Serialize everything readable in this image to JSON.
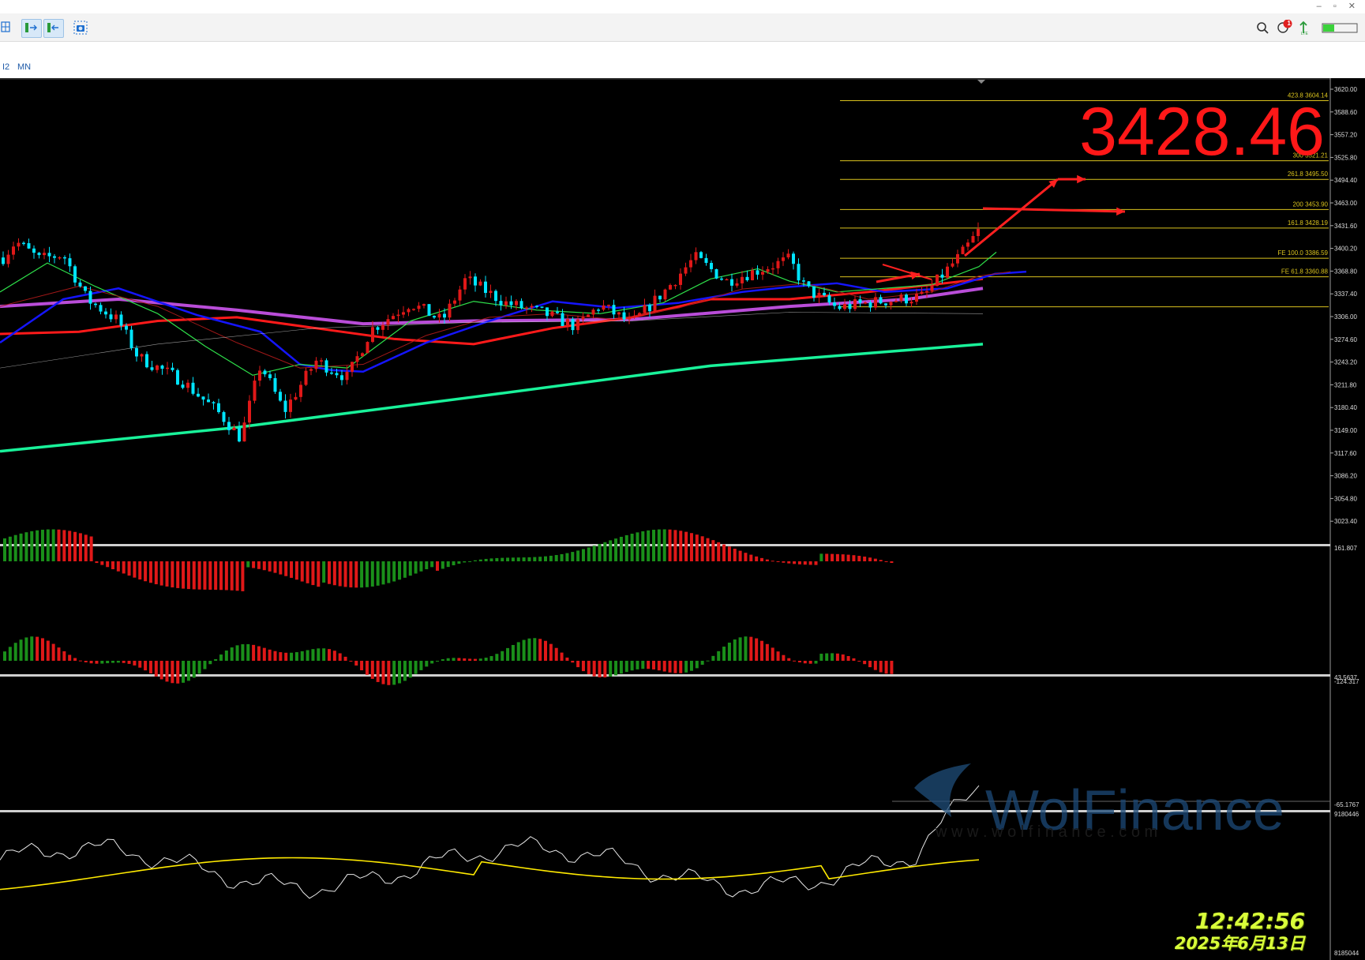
{
  "toolbar": {
    "timeframes": [
      "I2",
      "MN"
    ],
    "icons": [
      "grid-icon",
      "tile-horizontal-icon",
      "tile-vertical-icon",
      "screenshot-icon",
      "search-icon",
      "messages-icon",
      "signal-icon"
    ],
    "notification_count": "1",
    "window_controls": [
      "–",
      "▫",
      "✕"
    ]
  },
  "main_chart": {
    "price_display": "3428.46",
    "price_axis": [
      "3620.00",
      "3588.60",
      "3557.20",
      "3525.80",
      "3494.40",
      "3463.00",
      "3431.60",
      "3400.20",
      "3368.80",
      "3337.40",
      "3306.00",
      "3274.60",
      "3243.20",
      "3211.80",
      "3180.40",
      "3149.00",
      "3117.60",
      "3086.20",
      "3054.80",
      "3023.40"
    ],
    "fib_levels": [
      {
        "label": "423.8  3604.14",
        "price": 3604.14
      },
      {
        "label": "300  3521.21",
        "price": 3521.21
      },
      {
        "label": "261.8  3495.50",
        "price": 3495.5
      },
      {
        "label": "200  3453.90",
        "price": 3453.9
      },
      {
        "label": "161.8  3428.19",
        "price": 3428.19
      },
      {
        "label": "FE 100.0  3386.59",
        "price": 3386.59
      },
      {
        "label": "FE 61.8  3360.88",
        "price": 3360.88
      },
      {
        "label": "",
        "price": 3319.5
      }
    ],
    "colors": {
      "bull": "#e01818",
      "bear": "#00e5ff",
      "ma_blue": "#1515ff",
      "ma_red": "#ff1a1a",
      "ma_purple": "#b94dd8",
      "ma_green": "#19f29a",
      "fib": "#d9c21e",
      "arrow": "#ff2020"
    }
  },
  "macd_panel": {
    "top_label": "161.807",
    "bottom_label": "-124.317"
  },
  "osma_panel": {
    "top_label": "43.5637",
    "bottom_label": "-65.1767"
  },
  "volume_panel": {
    "top_label": "9180446",
    "bottom_label": "8185044"
  },
  "watermark": {
    "brand": "WolFinance",
    "url": "w w w . w o l f i n a n c e . c o m"
  },
  "timestamp": {
    "time": "12:42:56",
    "date": "2025年6月13日"
  }
}
